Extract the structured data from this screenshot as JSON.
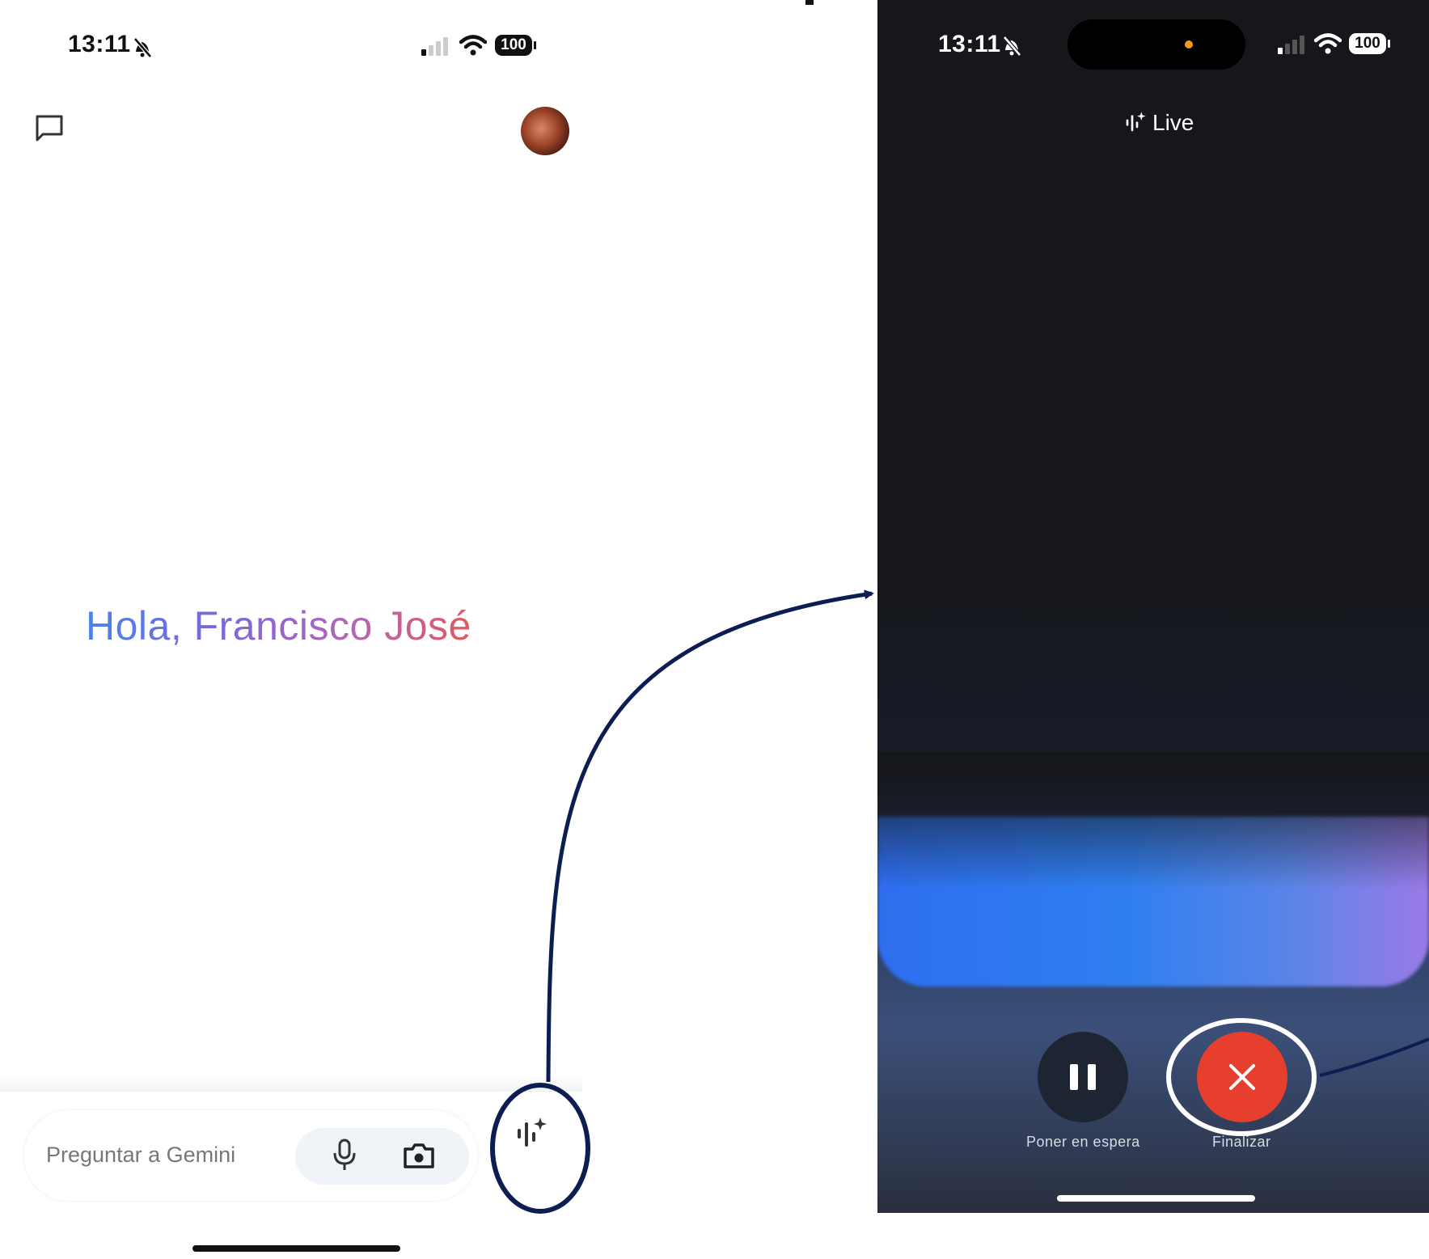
{
  "left": {
    "status": {
      "time": "13:11",
      "battery": "100"
    },
    "greeting": "Hola, Francisco José",
    "input": {
      "placeholder": "Preguntar a Gemini"
    },
    "icons": {
      "new_chat": "chat-bubble-icon",
      "avatar": "avatar",
      "mic": "mic-icon",
      "camera": "camera-icon",
      "live": "live-sparkle-icon"
    }
  },
  "right": {
    "status": {
      "time": "13:11",
      "battery": "100"
    },
    "header": {
      "title": "Live"
    },
    "controls": {
      "pause_label": "Poner en espera",
      "end_label": "Finalizar"
    },
    "colors": {
      "end_button": "#e63f2e",
      "pause_button": "#1d2533"
    }
  },
  "annotations": {
    "color": "#0b1d51"
  }
}
